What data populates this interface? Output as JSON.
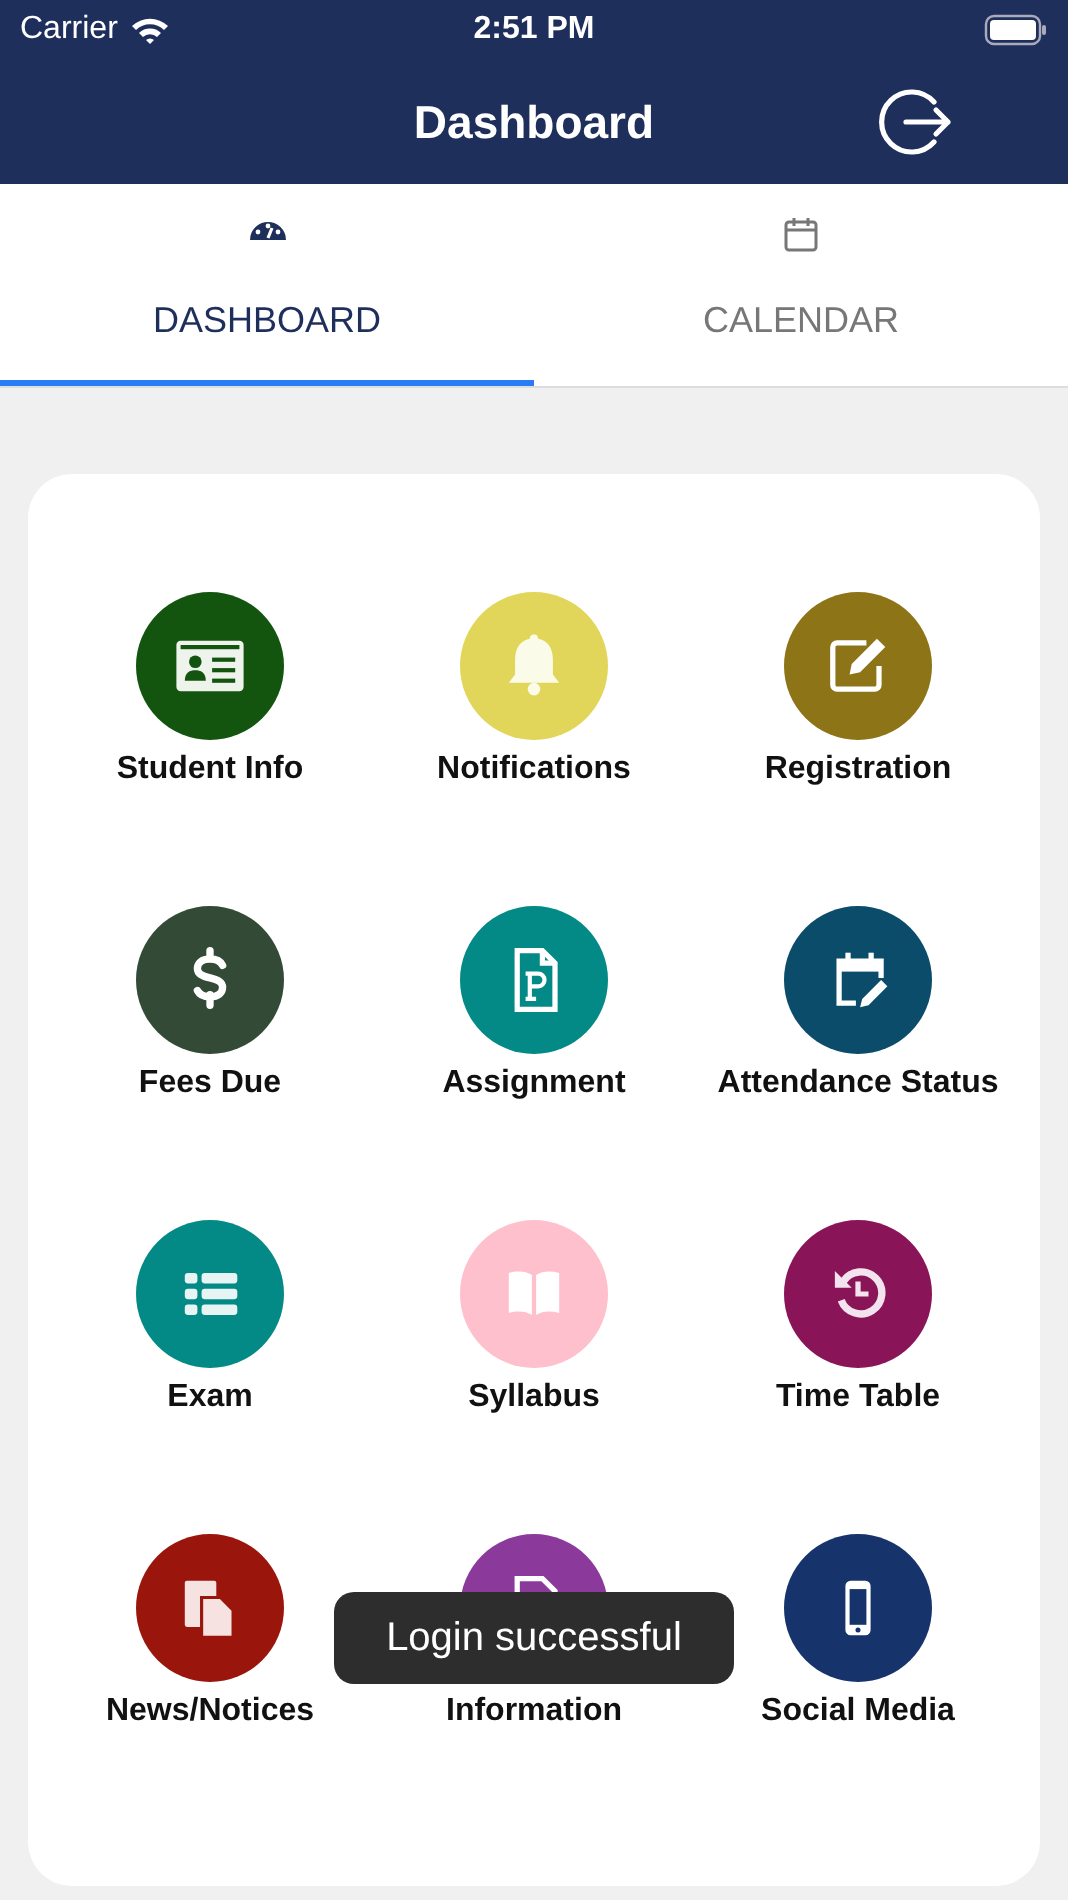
{
  "status_bar": {
    "carrier": "Carrier",
    "time": "2:51 PM"
  },
  "nav_bar": {
    "title": "Dashboard"
  },
  "tabs": [
    {
      "label": "DASHBOARD",
      "selected": true
    },
    {
      "label": "CALENDAR",
      "selected": false
    }
  ],
  "tiles": [
    {
      "label": "Student Info",
      "color": "#13550f"
    },
    {
      "label": "Notifications",
      "color": "#e2d65a"
    },
    {
      "label": "Registration",
      "color": "#8d7417"
    },
    {
      "label": "Fees Due",
      "color": "#334b36"
    },
    {
      "label": "Assignment",
      "color": "#048a86"
    },
    {
      "label": "Attendance Status",
      "color": "#0b4c6a"
    },
    {
      "label": "Exam",
      "color": "#048a86"
    },
    {
      "label": "Syllabus",
      "color": "#fec0cc"
    },
    {
      "label": "Time Table",
      "color": "#8a1458"
    },
    {
      "label": "News/Notices",
      "color": "#9a160d"
    },
    {
      "label": "Information",
      "color": "#8b3a9c"
    },
    {
      "label": "Social Media",
      "color": "#16346b"
    }
  ],
  "toast": {
    "message": "Login successful"
  }
}
